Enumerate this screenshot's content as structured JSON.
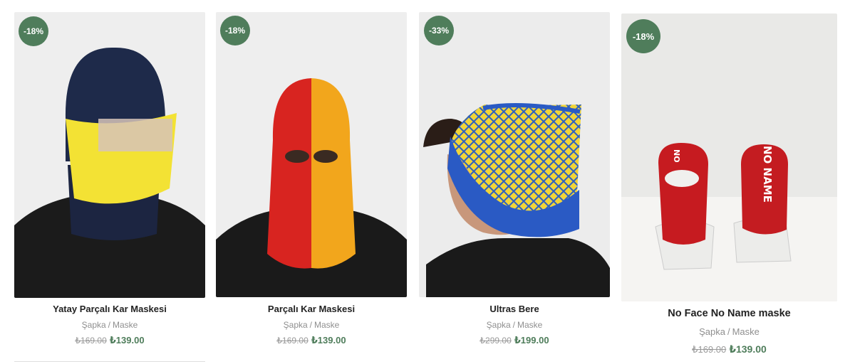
{
  "products": [
    {
      "discount_badge": "-18%",
      "title": "Yatay Parçalı Kar Maskesi",
      "category_1": "Şapka",
      "category_sep": "/",
      "category_2": "Maske",
      "old_price": "₺169.00",
      "new_price": "₺139.00",
      "image_desc": "navy-yellow-balaclava"
    },
    {
      "discount_badge": "-18%",
      "title": "Parçalı Kar Maskesi",
      "category_1": "Şapka",
      "category_sep": "/",
      "category_2": "Maske",
      "old_price": "₺169.00",
      "new_price": "₺139.00",
      "image_desc": "red-orange-balaclava"
    },
    {
      "discount_badge": "-33%",
      "title": "Ultras Bere",
      "category_1": "Şapka",
      "category_sep": "/",
      "category_2": "Maske",
      "old_price": "₺299.00",
      "new_price": "₺199.00",
      "image_desc": "blue-yellow-beanie"
    },
    {
      "discount_badge": "-18%",
      "title": "No Face No Name maske",
      "category_1": "Şapka",
      "category_sep": "/",
      "category_2": "Maske",
      "old_price": "₺169.00",
      "new_price": "₺139.00",
      "image_desc": "red-no-name-masks",
      "image_text": "NO NAME"
    }
  ],
  "colors": {
    "accent_green": "#4f7d5b",
    "title": "#222222",
    "muted": "#8f8f8f"
  }
}
